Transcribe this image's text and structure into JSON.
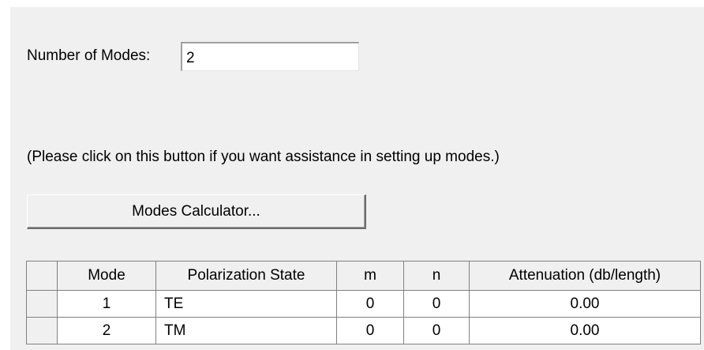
{
  "form": {
    "num_modes_label": "Number of Modes:",
    "num_modes_value": "2",
    "hint": "(Please click on this button if you want assistance in setting up modes.)",
    "calc_button_label": "Modes Calculator..."
  },
  "table": {
    "headers": [
      "Mode",
      "Polarization State",
      "m",
      "n",
      "Attenuation (db/length)"
    ],
    "rows": [
      [
        "1",
        "TE",
        "0",
        "0",
        "0.00"
      ],
      [
        "2",
        "TM",
        "0",
        "0",
        "0.00"
      ]
    ]
  }
}
